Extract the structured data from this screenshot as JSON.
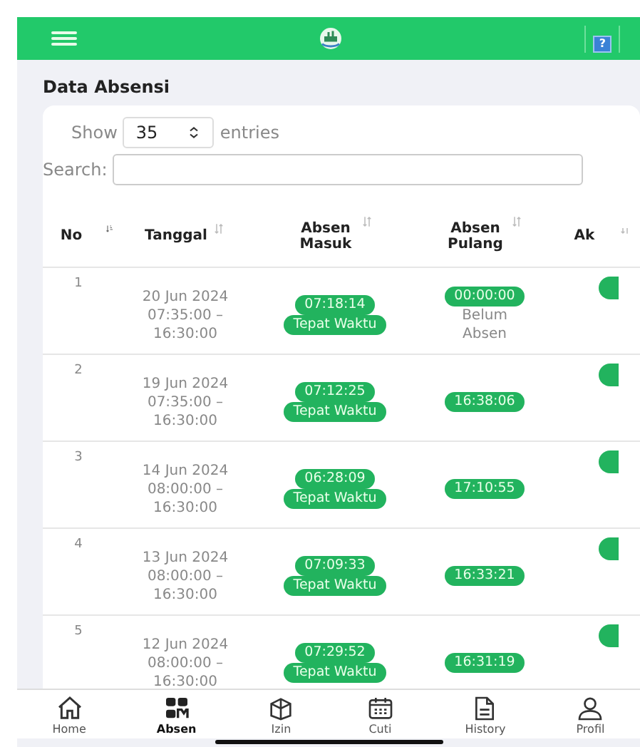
{
  "top_bar": {
    "help_label": "?"
  },
  "title": "Data Absensi",
  "length_control": {
    "prefix": "Show",
    "value": "35",
    "suffix": "entries"
  },
  "search": {
    "label": "Search:"
  },
  "table": {
    "columns": [
      {
        "label": "No",
        "sorted": true
      },
      {
        "label": "Tanggal",
        "sorted": false
      },
      {
        "label": "Absen Masuk",
        "sorted": false
      },
      {
        "label": "Absen Pulang",
        "sorted": false
      },
      {
        "label": "Ak",
        "sorted": false
      }
    ],
    "rows": [
      {
        "no": "1",
        "date": "20 Jun 2024",
        "shift": "07:35:00 – 16:30:00",
        "in_time": "07:18:14",
        "in_status": "Tepat Waktu",
        "out_time": "00:00:00",
        "out_note": "Belum Absen"
      },
      {
        "no": "2",
        "date": "19 Jun 2024",
        "shift": "07:35:00 – 16:30:00",
        "in_time": "07:12:25",
        "in_status": "Tepat Waktu",
        "out_time": "16:38:06"
      },
      {
        "no": "3",
        "date": "14 Jun 2024",
        "shift": "08:00:00 – 16:30:00",
        "in_time": "06:28:09",
        "in_status": "Tepat Waktu",
        "out_time": "17:10:55"
      },
      {
        "no": "4",
        "date": "13 Jun 2024",
        "shift": "08:00:00 – 16:30:00",
        "in_time": "07:09:33",
        "in_status": "Tepat Waktu",
        "out_time": "16:33:21"
      },
      {
        "no": "5",
        "date": "12 Jun 2024",
        "shift": "08:00:00 – 16:30:00",
        "in_time": "07:29:52",
        "in_status": "Tepat Waktu",
        "out_time": "16:31:19"
      }
    ]
  },
  "bottom_nav": [
    {
      "label": "Home",
      "kind": "home",
      "selected": false
    },
    {
      "label": "Absen",
      "kind": "scan",
      "selected": true
    },
    {
      "label": "Izin",
      "kind": "permit",
      "selected": false
    },
    {
      "label": "Cuti",
      "kind": "leave",
      "selected": false
    },
    {
      "label": "History",
      "kind": "history",
      "selected": false
    },
    {
      "label": "Profil",
      "kind": "profile",
      "selected": false
    }
  ]
}
